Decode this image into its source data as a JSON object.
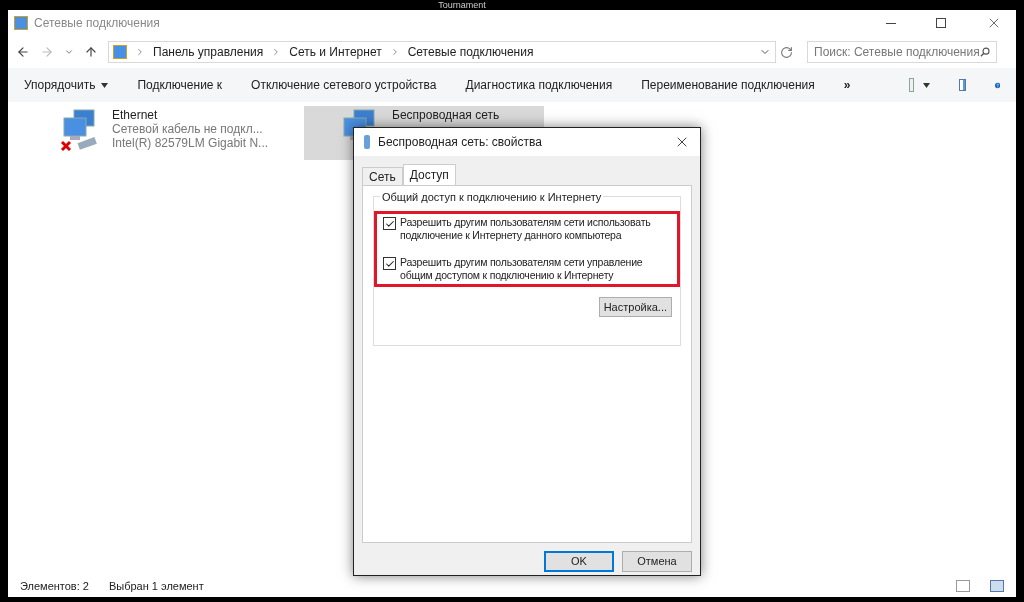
{
  "top_caption": "Tournament",
  "window": {
    "title": "Сетевые подключения"
  },
  "address": {
    "crumbs": [
      "Панель управления",
      "Сеть и Интернет",
      "Сетевые подключения"
    ]
  },
  "search": {
    "placeholder": "Поиск: Сетевые подключения"
  },
  "toolbar": {
    "items": [
      {
        "label": "Упорядочить",
        "dropdown": true
      },
      {
        "label": "Подключение к",
        "dropdown": false
      },
      {
        "label": "Отключение сетевого устройства",
        "dropdown": false
      },
      {
        "label": "Диагностика подключения",
        "dropdown": false
      },
      {
        "label": "Переименование подключения",
        "dropdown": false
      }
    ],
    "overflow": "»"
  },
  "connections": [
    {
      "kind": "wired",
      "name": "Ethernet",
      "status": "Сетевой кабель не подкл...",
      "device": "Intel(R) 82579LM Gigabit N...",
      "selected": false
    },
    {
      "kind": "wireless",
      "name": "Беспроводная сеть",
      "selected": true
    }
  ],
  "dialog": {
    "title": "Беспроводная сеть: свойства",
    "tabs": [
      {
        "label": "Сеть",
        "selected": false
      },
      {
        "label": "Доступ",
        "selected": true
      }
    ],
    "group_title": "Общий доступ к подключению к Интернету",
    "options": [
      {
        "label": "Разрешить другим пользователям сети использовать подключение к Интернету данного компьютера",
        "checked": true
      },
      {
        "label": "Разрешить другим пользователям сети управление общим доступом к подключению к Интернету",
        "checked": true
      }
    ],
    "settings_button": "Настройка...",
    "buttons": [
      {
        "label": "OK",
        "default": true
      },
      {
        "label": "Отмена",
        "default": false
      }
    ]
  },
  "status_bar": {
    "items": [
      "Элементов: 2",
      "Выбран 1 элемент"
    ]
  }
}
